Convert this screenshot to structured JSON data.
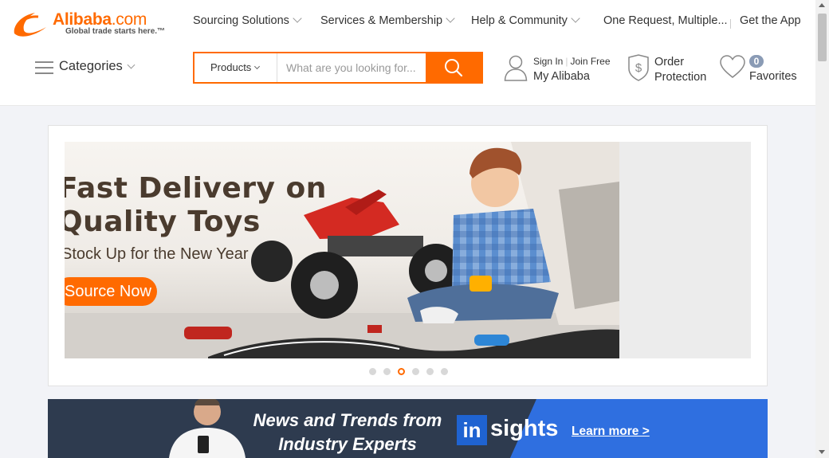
{
  "header": {
    "logo": {
      "wordmark": "Alibaba",
      "wordmark_suffix": ".com",
      "tagline": "Global trade starts here.™"
    },
    "nav": {
      "sourcing": "Sourcing Solutions",
      "services": "Services & Membership",
      "help": "Help & Community",
      "one_request": "One Request, Multiple...",
      "get_app": "Get the App"
    },
    "categories_label": "Categories",
    "search": {
      "category": "Products",
      "placeholder": "What are you looking for..."
    },
    "account": {
      "sign_in": "Sign In",
      "join_free": "Join Free",
      "my_alibaba": "My Alibaba"
    },
    "order_protection": {
      "line1": "Order",
      "line2": "Protection"
    },
    "favorites": {
      "count": "0",
      "label": "Favorites"
    }
  },
  "carousel": {
    "slide": {
      "headline_line1": "Fast Delivery on",
      "headline_line2": "Quality Toys",
      "subline": "Stock Up for the New Year",
      "cta": "Source Now"
    },
    "dots_count": 6,
    "active_dot": 2
  },
  "insights_banner": {
    "text_line1": "News and Trends from",
    "text_line2": "Industry Experts",
    "logo_in": "in",
    "logo_rest": "sights",
    "cta": "Learn more >"
  },
  "colors": {
    "brand_orange": "#ff6a00",
    "banner_dark": "#2e3b4f",
    "banner_blue": "#2f6fe0"
  }
}
